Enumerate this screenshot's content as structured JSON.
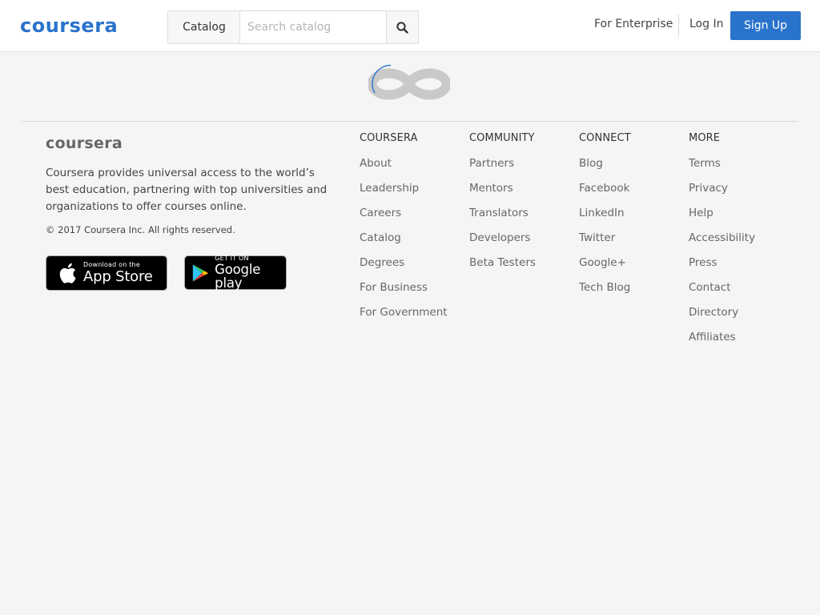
{
  "header": {
    "logo_text": "coursera",
    "catalog_label": "Catalog",
    "search_placeholder": "Search catalog",
    "for_enterprise_label": "For Enterprise",
    "login_label": "Log In",
    "signup_label": "Sign Up"
  },
  "loader": {
    "icon": "coursera-loading-icon"
  },
  "footer": {
    "logo_text": "coursera",
    "description": "Coursera provides universal access to the world’s best education, partnering with top universities and organizations to offer courses online.",
    "copyright": "© 2017 Coursera Inc. All rights reserved.",
    "app_store": {
      "small": "Download on the",
      "big": "App Store"
    },
    "google_play": {
      "small": "GET IT ON",
      "big": "Google play"
    },
    "columns": [
      {
        "heading": "COURSERA",
        "links": [
          "About",
          "Leadership",
          "Careers",
          "Catalog",
          "Degrees",
          "For Business",
          "For Government"
        ]
      },
      {
        "heading": "COMMUNITY",
        "links": [
          "Partners",
          "Mentors",
          "Translators",
          "Developers",
          "Beta Testers"
        ]
      },
      {
        "heading": "CONNECT",
        "links": [
          "Blog",
          "Facebook",
          "LinkedIn",
          "Twitter",
          "Google+",
          "Tech Blog"
        ]
      },
      {
        "heading": "MORE",
        "links": [
          "Terms",
          "Privacy",
          "Help",
          "Accessibility",
          "Press",
          "Contact",
          "Directory",
          "Affiliates"
        ]
      }
    ]
  },
  "colors": {
    "brand_blue": "#2a73cc",
    "logo_blue": "#2a73cc",
    "footer_logo_gray": "#666666",
    "loader_gray": "#c9c9c9"
  }
}
